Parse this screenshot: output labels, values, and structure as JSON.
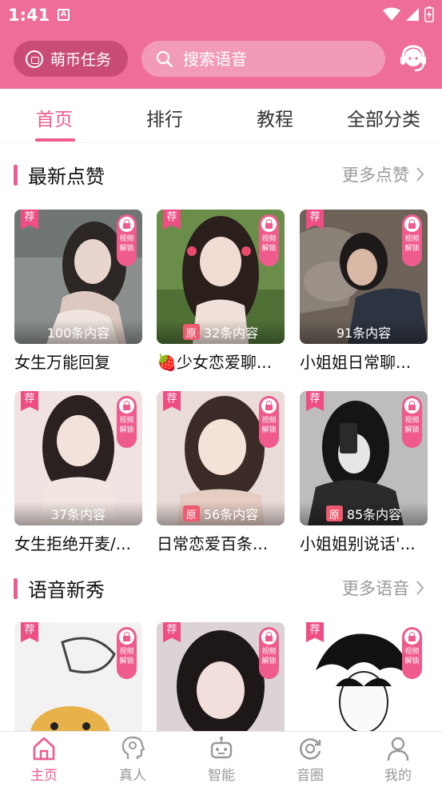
{
  "status_bar": {
    "time": "1:41",
    "app_icon_letter": "A"
  },
  "header": {
    "coin_task_label": "萌币任务",
    "search_placeholder": "搜索语音"
  },
  "tabs": [
    {
      "label": "首页",
      "active": true
    },
    {
      "label": "排行",
      "active": false
    },
    {
      "label": "教程",
      "active": false
    },
    {
      "label": "全部分类",
      "active": false
    }
  ],
  "sections": [
    {
      "title": "最新点赞",
      "more": "更多点赞"
    },
    {
      "title": "语音新秀",
      "more": "更多语音"
    }
  ],
  "badges": {
    "recommend": "荐",
    "original": "原",
    "lock_line1": "视频",
    "lock_line2": "解锁"
  },
  "cards_latest": [
    {
      "title": "女生万能回复",
      "count": "100条内容",
      "original": false
    },
    {
      "title": "🍓少女恋爱聊...",
      "count": "32条内容",
      "original": true
    },
    {
      "title": "小姐姐日常聊...",
      "count": "91条内容",
      "original": false
    },
    {
      "title": "女生拒绝开麦/...",
      "count": "37条内容",
      "original": false
    },
    {
      "title": "日常恋爱百条...",
      "count": "56条内容",
      "original": true
    },
    {
      "title": "小姐姐别说话'...",
      "count": "85条内容",
      "original": true
    }
  ],
  "bottom_nav": [
    {
      "label": "主页",
      "icon": "home-icon",
      "active": true
    },
    {
      "label": "真人",
      "icon": "person-head-icon",
      "active": false
    },
    {
      "label": "智能",
      "icon": "robot-icon",
      "active": false
    },
    {
      "label": "音圈",
      "icon": "circle-refresh-icon",
      "active": false
    },
    {
      "label": "我的",
      "icon": "user-icon",
      "active": false
    }
  ],
  "colors": {
    "primary": "#ee6d99",
    "accent": "#ee5b8c"
  }
}
